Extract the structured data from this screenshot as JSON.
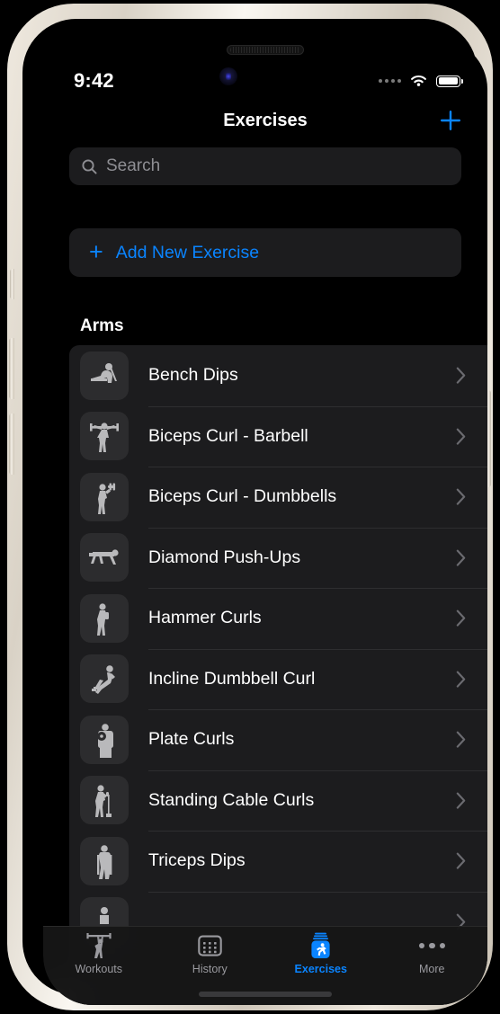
{
  "status_bar": {
    "time": "9:42",
    "cellular_icon": "signal-dots-icon",
    "wifi_icon": "wifi-icon",
    "battery_icon": "battery-full-icon"
  },
  "nav": {
    "title": "Exercises",
    "add_button_label": "+",
    "add_button_icon": "plus-icon",
    "accent_color": "#0a84ff"
  },
  "search": {
    "placeholder": "Search",
    "value": "",
    "icon": "search-icon"
  },
  "add_new": {
    "label": "Add New Exercise",
    "icon": "plus-icon"
  },
  "sections": [
    {
      "header": "Arms",
      "items": [
        {
          "name": "Bench Dips",
          "thumb_icon": "bench-dips-figure-icon",
          "chevron": "chevron-right-icon"
        },
        {
          "name": "Biceps Curl - Barbell",
          "thumb_icon": "barbell-curl-figure-icon",
          "chevron": "chevron-right-icon"
        },
        {
          "name": "Biceps Curl - Dumbbells",
          "thumb_icon": "dumbbell-curl-figure-icon",
          "chevron": "chevron-right-icon"
        },
        {
          "name": "Diamond Push-Ups",
          "thumb_icon": "pushup-figure-icon",
          "chevron": "chevron-right-icon"
        },
        {
          "name": "Hammer Curls",
          "thumb_icon": "hammer-curl-figure-icon",
          "chevron": "chevron-right-icon"
        },
        {
          "name": "Incline Dumbbell Curl",
          "thumb_icon": "incline-curl-figure-icon",
          "chevron": "chevron-right-icon"
        },
        {
          "name": "Plate Curls",
          "thumb_icon": "plate-curl-figure-icon",
          "chevron": "chevron-right-icon"
        },
        {
          "name": "Standing Cable Curls",
          "thumb_icon": "cable-curl-figure-icon",
          "chevron": "chevron-right-icon"
        },
        {
          "name": "Triceps Dips",
          "thumb_icon": "triceps-dips-figure-icon",
          "chevron": "chevron-right-icon"
        },
        {
          "name": "",
          "thumb_icon": "partial-figure-icon",
          "chevron": "chevron-right-icon"
        }
      ]
    }
  ],
  "tab_bar": {
    "active": "Exercises",
    "tabs": [
      {
        "label": "Workouts",
        "icon": "barbell-lift-icon"
      },
      {
        "label": "History",
        "icon": "calendar-icon"
      },
      {
        "label": "Exercises",
        "icon": "exercise-jar-runner-icon"
      },
      {
        "label": "More",
        "icon": "ellipsis-icon"
      }
    ]
  }
}
